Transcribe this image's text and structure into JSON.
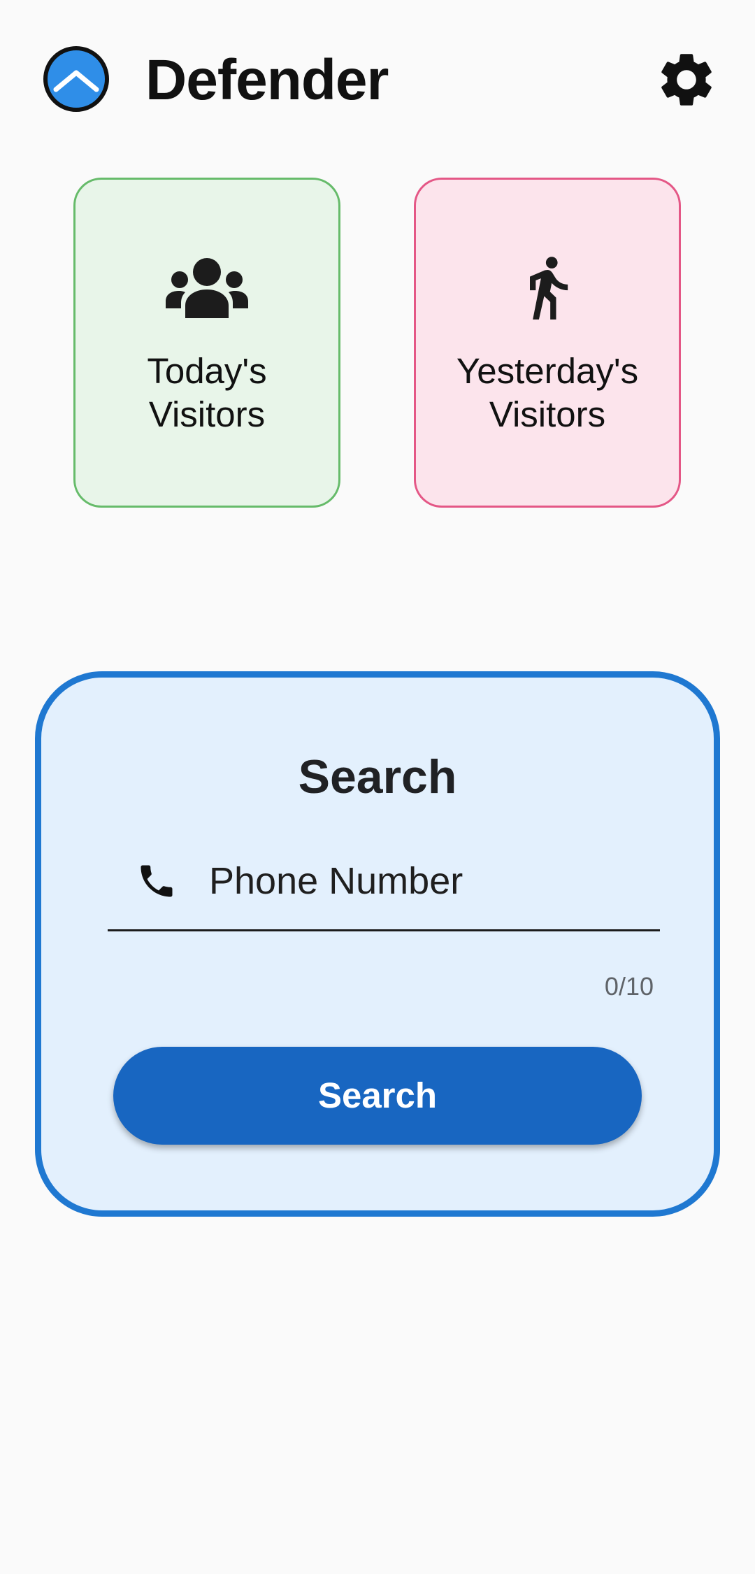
{
  "header": {
    "app_title": "Defender",
    "logo_icon": "chevron-up-circle-logo",
    "settings_icon": "gear-icon"
  },
  "tiles": [
    {
      "line1": "Today's",
      "line2": "Visitors",
      "icon": "group-icon",
      "background": "#e8f5e9",
      "border": "#66bb6a"
    },
    {
      "line1": "Yesterday's",
      "line2": "Visitors",
      "icon": "walking-person-icon",
      "background": "#fce4ec",
      "border": "#e45786"
    }
  ],
  "search": {
    "title": "Search",
    "phone_placeholder": "Phone Number",
    "phone_value": "",
    "phone_icon": "phone-icon",
    "counter": "0/10",
    "button_label": "Search"
  },
  "colors": {
    "accent": "#1866c1",
    "card_border": "#1f78d1",
    "card_background": "#e3f0fd",
    "logo_blue": "#2f8ee8"
  }
}
